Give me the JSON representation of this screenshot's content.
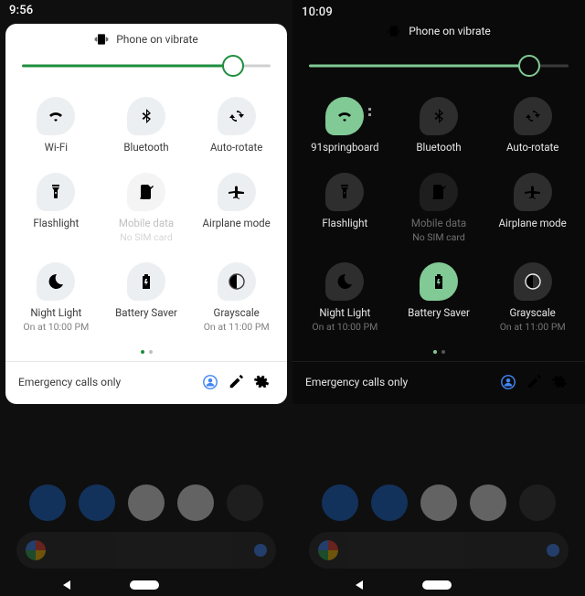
{
  "left": {
    "time": "9:56",
    "dnd_text": "Phone on vibrate",
    "tiles": [
      {
        "label": "Wi-Fi",
        "icon": "wifi",
        "state": "off"
      },
      {
        "label": "Bluetooth",
        "icon": "bluetooth",
        "state": "off"
      },
      {
        "label": "Auto-rotate",
        "icon": "rotate",
        "state": "off"
      },
      {
        "label": "Flashlight",
        "icon": "flashlight",
        "state": "off"
      },
      {
        "label": "Mobile data",
        "sub": "No SIM card",
        "icon": "sim",
        "state": "dim"
      },
      {
        "label": "Airplane mode",
        "icon": "airplane",
        "state": "off"
      },
      {
        "label": "Night Light",
        "sub": "On at 10:00 PM",
        "icon": "moon",
        "state": "off"
      },
      {
        "label": "Battery Saver",
        "icon": "battery",
        "state": "off"
      },
      {
        "label": "Grayscale",
        "sub": "On at 11:00 PM",
        "icon": "contrast",
        "state": "off"
      }
    ],
    "footer_status": "Emergency calls only"
  },
  "right": {
    "time": "10:09",
    "dnd_text": "Phone on vibrate",
    "tiles": [
      {
        "label": "91springboard",
        "icon": "wifi",
        "state": "on"
      },
      {
        "label": "Bluetooth",
        "icon": "bluetooth",
        "state": "off"
      },
      {
        "label": "Auto-rotate",
        "icon": "rotate",
        "state": "off"
      },
      {
        "label": "Flashlight",
        "icon": "flashlight",
        "state": "off"
      },
      {
        "label": "Mobile data",
        "sub": "No SIM card",
        "icon": "sim",
        "state": "dim"
      },
      {
        "label": "Airplane mode",
        "icon": "airplane",
        "state": "off"
      },
      {
        "label": "Night Light",
        "sub": "On at 10:00 PM",
        "icon": "moon",
        "state": "off"
      },
      {
        "label": "Battery Saver",
        "icon": "battery",
        "state": "on"
      },
      {
        "label": "Grayscale",
        "sub": "On at 11:00 PM",
        "icon": "contrast",
        "state": "off"
      }
    ],
    "footer_status": "Emergency calls only"
  }
}
